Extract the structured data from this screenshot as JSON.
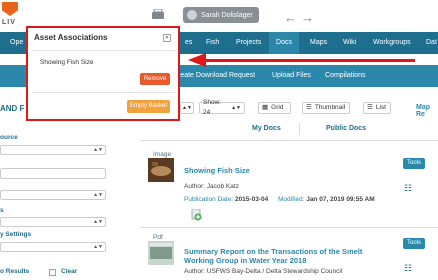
{
  "header": {
    "logo_text": "LIV",
    "user_name": "Sarah Dolislager",
    "icons": [
      "basket-icon",
      "user-icon",
      "back-arrow-icon",
      "forward-arrow-icon"
    ]
  },
  "nav": {
    "items": [
      "Ope",
      "es",
      "Fish",
      "Projects",
      "Docs",
      "Maps",
      "Wiki",
      "Workgroups",
      "Dat"
    ],
    "active": "Docs"
  },
  "subnav": {
    "items": [
      "reate Download Request",
      "Upload Files",
      "Compilations"
    ]
  },
  "sidebar": {
    "title": "AND F",
    "labels": [
      "ource",
      "s",
      "y Settings"
    ],
    "results_label": "o Results",
    "clear_label": "Clear"
  },
  "toolbar": {
    "show_label": "Show: 24",
    "grid_label": "Grid",
    "thumbnail_label": "Thumbnail",
    "list_label": "List",
    "map_link": "Map Re",
    "tab_my_docs": "My Docs",
    "tab_public_docs": "Public Docs"
  },
  "results": [
    {
      "type": "Image",
      "title": "Showing Fish Size",
      "author_label": "Author:",
      "author": "Jacob Katz",
      "pub_label": "Publication Date:",
      "pub_date": "2015-03-04",
      "mod_label": "Modified:",
      "mod_date": "Jan 07, 2019 09:55 AM",
      "tools_label": "Tools"
    },
    {
      "type": "Pdf",
      "title": "Summary Report on the Transactions of the Smelt Working Group in Water Year 2018",
      "author_label": "Author:",
      "author": "USFWS Bay-Delta / Delta Stewardship Council",
      "tools_label": "Tools"
    }
  ],
  "modal": {
    "title": "Asset Associations",
    "item": "Showing Fish Size",
    "remove_label": "Remove",
    "empty_label": "Empty Basket"
  },
  "colors": {
    "nav": "#1e6e8e",
    "accent": "#2b88ab",
    "highlight": "#e01717",
    "remove": "#e85a2a",
    "empty": "#f2a23c"
  }
}
